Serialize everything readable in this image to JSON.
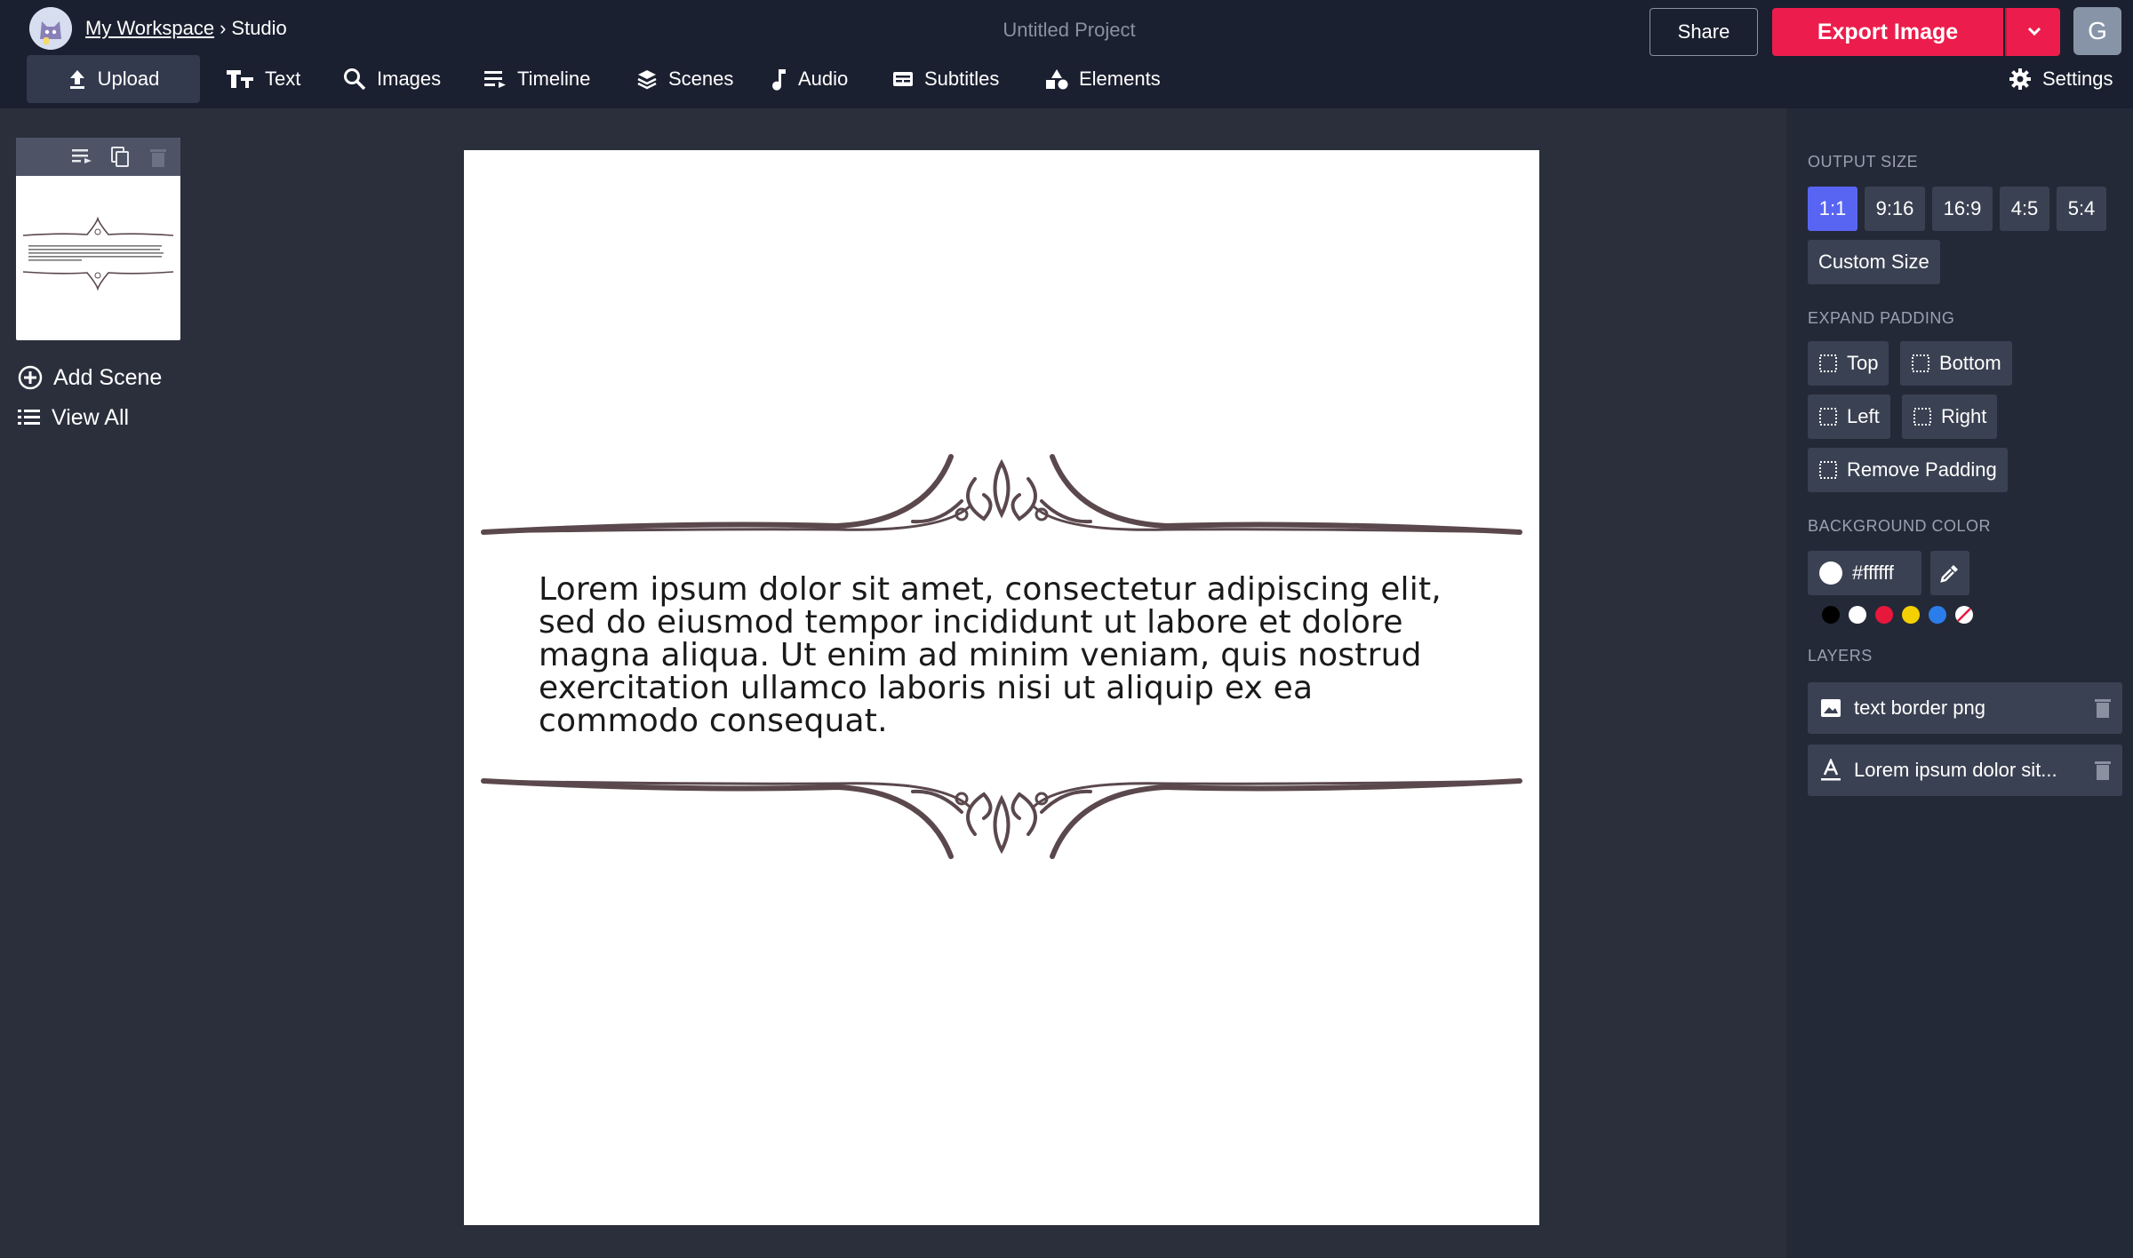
{
  "breadcrumb": {
    "workspace": "My Workspace",
    "separator": "›",
    "current": "Studio"
  },
  "project": {
    "title": "Untitled Project"
  },
  "header": {
    "share_label": "Share",
    "export_label": "Export Image",
    "user_initial": "G"
  },
  "toolbar": {
    "items": [
      {
        "label": "Upload",
        "icon": "upload-icon"
      },
      {
        "label": "Text",
        "icon": "text-icon"
      },
      {
        "label": "Images",
        "icon": "search-icon"
      },
      {
        "label": "Timeline",
        "icon": "timeline-icon"
      },
      {
        "label": "Scenes",
        "icon": "layers-icon"
      },
      {
        "label": "Audio",
        "icon": "music-note-icon"
      },
      {
        "label": "Subtitles",
        "icon": "subtitles-icon"
      },
      {
        "label": "Elements",
        "icon": "shapes-icon"
      }
    ],
    "settings_label": "Settings"
  },
  "scenes": {
    "add_label": "Add Scene",
    "view_all_label": "View All",
    "thumb_text": "Lorem ipsum dolor sit amet, consectetur adipiscing elit, sed do eiusmod tempor incididunt ut labore et dolore magna aliqua. Ut enim ad minim veniam, quis nostrud exercitation ullamco laboris nisi ut aliquip ex ea commodo consequat."
  },
  "canvas": {
    "text": "Lorem ipsum dolor sit amet, consectetur adipiscing elit, sed do eiusmod tempor incididunt ut labore et dolore magna aliqua. Ut enim ad minim veniam, quis nostrud exercitation ullamco laboris nisi ut aliquip ex ea commodo consequat.",
    "background": "#ffffff",
    "ornament_color": "#5a484d"
  },
  "panel": {
    "output_size_label": "OUTPUT SIZE",
    "sizes": [
      "1:1",
      "9:16",
      "16:9",
      "4:5",
      "5:4"
    ],
    "active_size": "1:1",
    "custom_size_label": "Custom Size",
    "expand_padding_label": "EXPAND PADDING",
    "padding": {
      "top": "Top",
      "bottom": "Bottom",
      "left": "Left",
      "right": "Right",
      "remove": "Remove Padding"
    },
    "background_color_label": "BACKGROUND COLOR",
    "background_color_value": "#ffffff",
    "swatches": [
      "#000000",
      "#ffffff",
      "#e8173c",
      "#f5d000",
      "#2b7de9",
      "none"
    ],
    "layers_label": "LAYERS",
    "layers": [
      {
        "name": "text border png",
        "icon": "image-icon"
      },
      {
        "name": "Lorem ipsum dolor sit...",
        "icon": "text-format-icon"
      }
    ]
  },
  "colors": {
    "accent": "#5865f2",
    "export": "#ec1d4c",
    "topbar": "#1b2030",
    "background": "#2b2f3c"
  }
}
